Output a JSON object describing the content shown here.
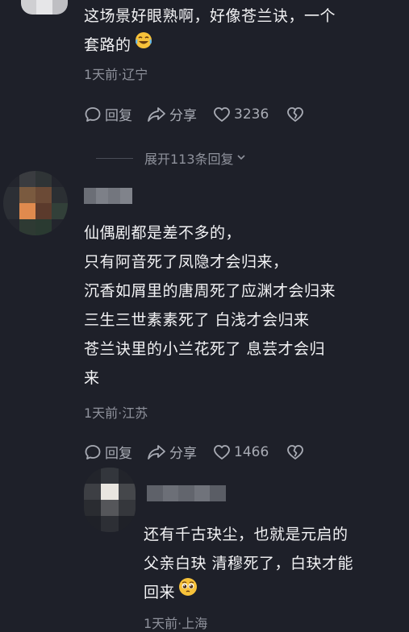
{
  "comments": [
    {
      "lines": [
        "这场景好眼熟啊，好像苍兰诀，一个",
        "套路的"
      ],
      "emoji": "laughing-tears-emoji",
      "meta": "1天前·辽宁",
      "reply_label": "回复",
      "share_label": "分享",
      "like_count": "3236"
    },
    {
      "lines": [
        "仙偶剧都是差不多的，",
        "只有阿音死了凤隐才会归来，",
        "沉香如屑里的唐周死了应渊才会归来",
        "三生三世素素死了 白浅才会归来",
        "苍兰诀里的小兰花死了 息芸才会归",
        "来"
      ],
      "meta": "1天前·江苏",
      "reply_label": "回复",
      "share_label": "分享",
      "like_count": "1466"
    },
    {
      "lines": [
        "还有千古玦尘，也就是元启的",
        "父亲白玦 清穆死了，白玦才能",
        "回来"
      ],
      "emoji": "pleading-face-emoji",
      "meta": "1天前·上海"
    }
  ],
  "expand_replies": {
    "label": "展开113条回复"
  },
  "colors": {
    "background": "#1e2029",
    "text": "#f2f2f4",
    "meta": "#8f929c",
    "action": "#a8abb4"
  },
  "icons": {
    "reply": "speech-bubble-icon",
    "share": "share-arrow-icon",
    "like": "heart-icon",
    "dislike": "broken-heart-icon",
    "expand": "chevron-down-icon"
  }
}
